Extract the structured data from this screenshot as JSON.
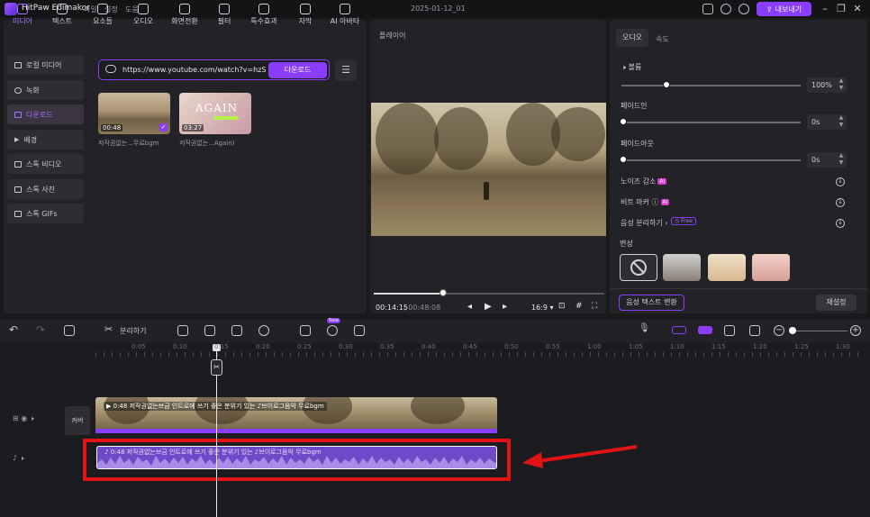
{
  "app": {
    "name": "HitPaw Edimakor",
    "project_title": "2025-01-12_01",
    "export_label": "내보내기"
  },
  "menu": [
    "파일",
    "설정",
    "도움"
  ],
  "tool_tabs": [
    "미디어",
    "텍스트",
    "요소들",
    "오디오",
    "화면전환",
    "필터",
    "특수효과",
    "자막",
    "AI 아바타"
  ],
  "sidebar": [
    "로컬 미디어",
    "녹화",
    "다운로드",
    "배경",
    "스톡 비디오",
    "스톡 사진",
    "스톡 GIFs"
  ],
  "download": {
    "url": "https://www.youtube.com/watch?v=hzSima",
    "button": "다운로드"
  },
  "thumbnails": [
    {
      "duration": "00:48",
      "caption": "저작권없는...무료bgm"
    },
    {
      "duration": "03:27",
      "caption": "저작권없는...Again)",
      "overlay": "AGAIN"
    }
  ],
  "player": {
    "label": "플레이어",
    "current": "00:14:15",
    "total": "/ 00:48:08",
    "ratio": "16:9",
    "progress": 0.3
  },
  "right_panel": {
    "tabs": [
      "오디오",
      "속도"
    ],
    "volume_label": "볼륨",
    "volume_value": "100%",
    "volume_level": 0.25,
    "fadein_label": "페이드인",
    "fadein_value": "0s",
    "fadeout_label": "페이드아웃",
    "fadeout_value": "0s",
    "noise_label": "노이즈 감소",
    "beat_label": "비트 마커",
    "separate_label": "음성 분리하기",
    "free_badge": "Free",
    "ai_badge": "AI",
    "voice_label": "변성",
    "speech_button": "음성 텍스트 변환",
    "reset_button": "재설정"
  },
  "timeline": {
    "split_label": "분리하기",
    "new_badge": "New",
    "ruler": [
      "0:05",
      "0:10",
      "0:15",
      "0:20",
      "0:25",
      "0:30",
      "0:35",
      "0:40",
      "0:45",
      "0:50",
      "0:55",
      "1:00",
      "1:05",
      "1:10",
      "1:15",
      "1:20",
      "1:25",
      "1:30"
    ],
    "cover_label": "커버",
    "video_clip": "0:48 저작권없는브금 인트로에 쓰기 좋은 분위기 있는 ♪브이로그음악 무료bgm",
    "audio_clip": "0:48 저작권없는브금 인트로에 쓰기 좋은 분위기 있는 ♪브이로그음악 무료bgm"
  },
  "colors": {
    "accent": "#8b3dff",
    "highlight": "#e01414",
    "audio_track": "#6f49c7"
  }
}
